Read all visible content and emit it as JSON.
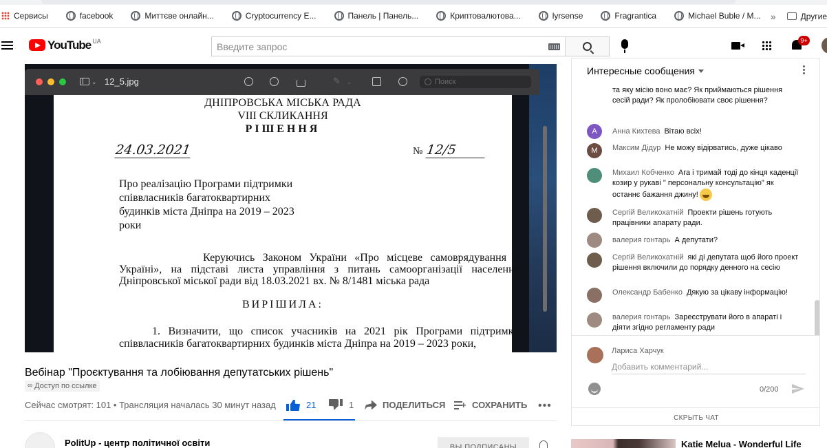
{
  "bookmarks": {
    "items": [
      {
        "label": "Сервисы"
      },
      {
        "label": "facebook"
      },
      {
        "label": "Миттєве онлайн..."
      },
      {
        "label": "Cryptocurrency E..."
      },
      {
        "label": "Панель | Панель..."
      },
      {
        "label": "Криптовалютова..."
      },
      {
        "label": "lyrsense"
      },
      {
        "label": "Fragrantica"
      },
      {
        "label": "Michael Buble / M..."
      }
    ],
    "more": "»",
    "other": "Другие"
  },
  "header": {
    "logo": "YouTube",
    "country": "UA",
    "search_placeholder": "Введите запрос",
    "notifications": "9+"
  },
  "viewer": {
    "file_name": "12_5.jpg",
    "search_placeholder": "Поиск"
  },
  "document": {
    "council": "ДНІПРОВСЬКА МІСЬКА РАДА",
    "convocation": "VIII СКЛИКАННЯ",
    "decision": "РІШЕННЯ",
    "date": "24.03.2021",
    "number_label": "№",
    "number": "12/5",
    "subject": "Про реалізацію Програми підтримки співвласників багатоквартирних будинків міста Дніпра на 2019 – 2023 роки",
    "preamble": "Керуючись Законом України «Про місцеве самоврядування в Україні», на підставі листа управління з питань самоорганізації населення Дніпровської міської ради від 18.03.2021 вх. № 8/1481 міська рада",
    "resolved": "ВИРІШИЛА:",
    "item1": "1. Визначити, що список учасників на 2021 рік Програми підтримки співвласників багатоквартирних будинків міста Дніпра на 2019 – 2023 роки,"
  },
  "video": {
    "title": "Вебінар \"Проєктування та лобіювання депутатських рішень\"",
    "access": "Доступ по ссылке",
    "stats": "Сейчас смотрят: 101 • Трансляция началась 30 минут назад",
    "likes": "21",
    "dislikes": "1",
    "share_label": "ПОДЕЛИТЬСЯ",
    "save_label": "СОХРАНИТЬ",
    "more": "•••"
  },
  "channel": {
    "name": "PolitUp - центр політичної освіти",
    "subscribed_label": "ВЫ ПОДПИСАНЫ"
  },
  "chat": {
    "title": "Интересные сообщения",
    "messages": [
      {
        "author": "",
        "text": "та яку місію воно має? Як приймаються рішення сесій ради? Як пролобіювати своє рішення?",
        "initial": "",
        "color": ""
      },
      {
        "author": "Анна Кихтева",
        "text": "Вітаю всіх!",
        "initial": "А",
        "color": "#7e57c2"
      },
      {
        "author": "Максим Дідур",
        "text": "Не можу відірватись, дуже цікаво",
        "initial": "М",
        "color": "#6d4c41"
      },
      {
        "author": "Михаил Кобченко",
        "text": "Ага і тримай тоді до кінця каденції козир у рукаві \" персональну консультацію\" як останнє бажання джину!",
        "initial": "",
        "color": "#4f8f7a"
      },
      {
        "author": "Сергій Великохатній",
        "text": "Проекти рішень готують працівники апарату ради.",
        "initial": "",
        "color": "#6e5d4d"
      },
      {
        "author": "валерия гонтарь",
        "text": "А депутати?",
        "initial": "",
        "color": "#9e8a80"
      },
      {
        "author": "Сергій Великохатній",
        "text": "які ді депутата щоб його проект рішення включили до порядку денного на сесію",
        "initial": "",
        "color": "#6e5d4d"
      },
      {
        "author": "Олександр Бабенко",
        "text": "Дякую за цікаву інформацію!",
        "initial": "",
        "color": "#8a6f63"
      },
      {
        "author": "валерия гонтарь",
        "text": "Зареєструвати його в апараті і діяти згідно регламенту ради",
        "initial": "",
        "color": "#9e8a80"
      }
    ],
    "me_name": "Лариса Харчук",
    "input_placeholder": "Добавить комментарий...",
    "counter": "0/200",
    "hide_label": "СКРЫТЬ ЧАТ"
  },
  "recommendation": {
    "title": "Katie Melua - Wonderful Life"
  }
}
